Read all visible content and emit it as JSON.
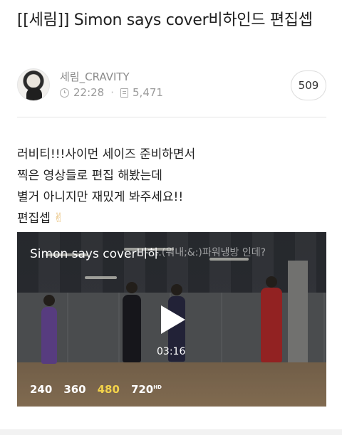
{
  "post": {
    "title": "[[세림]] Simon says cover비하인드 편집셉",
    "author": "세림_CRAVITY",
    "time": "22:28",
    "views": "5,471",
    "comment_count": "509"
  },
  "body": {
    "lines": [
      "러비티!!!사이먼 세이즈 준비하면서",
      "찍은 영상들로 편집 해봤는데",
      "별거 아니지만 재밌게 봐주세요!!",
      "편집셉"
    ],
    "emoji": "✌"
  },
  "video": {
    "title": "Simon says cover비하",
    "overlay_text": "- ...(워내;&:)파워냉방 인데?",
    "duration": "03:16",
    "qualities": [
      "240",
      "360",
      "480",
      "720"
    ],
    "hd_badge": "HD",
    "selected_quality": "480",
    "selected_color": "#f3d34a"
  },
  "icons": {
    "time": "clock-icon",
    "views": "document-icon",
    "play": "play-icon"
  }
}
